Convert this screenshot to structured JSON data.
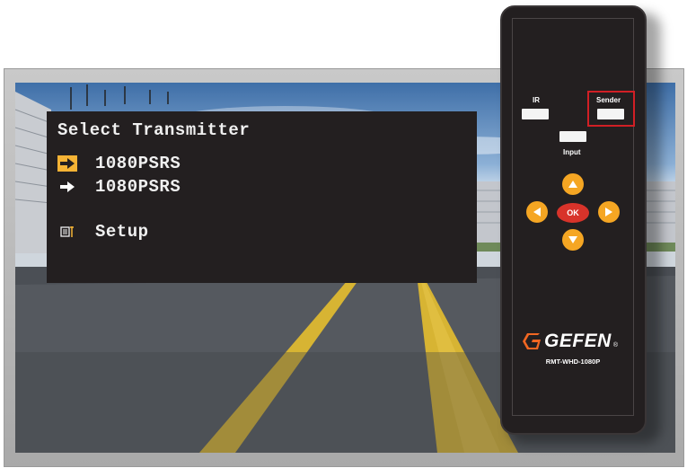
{
  "osd": {
    "title": "Select Transmitter",
    "items": [
      {
        "label": "1080PSRS",
        "icon": "arrow-right-icon",
        "selected": true
      },
      {
        "label": "1080PSRS",
        "icon": "arrow-right-icon",
        "selected": false
      },
      {
        "label": "Setup",
        "icon": "setup-icon",
        "selected": false
      }
    ]
  },
  "remote": {
    "ir_label": "IR",
    "sender_label": "Sender",
    "input_label": "Input",
    "ok_label": "OK",
    "brand": "GEFEN",
    "brand_mark": "®",
    "model": "RMT-WHD-1080P"
  },
  "colors": {
    "osd_bg": "#231f20",
    "selected_accent": "#f5b335",
    "dpad": "#f5a623",
    "ok": "#d8332a",
    "highlight": "#d11f25",
    "brand_logo": "#f26722"
  }
}
